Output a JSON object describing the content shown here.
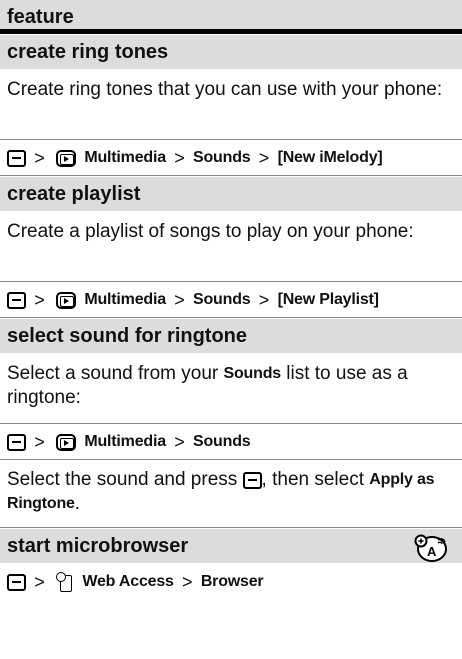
{
  "header": {
    "title": "feature"
  },
  "sections": [
    {
      "title": "create ring tones",
      "description": "Create ring tones that you can use with your phone:",
      "path": [
        "Multimedia",
        "Sounds",
        "[New iMelody]"
      ]
    },
    {
      "title": "create playlist",
      "description": "Create a playlist of songs to play on your phone:",
      "path": [
        "Multimedia",
        "Sounds",
        "[New Playlist]"
      ]
    },
    {
      "title": "select sound for ringtone",
      "desc_part1": "Select a sound from your",
      "desc_bold": "Sounds",
      "desc_part2": "list to use as a ringtone:",
      "path": [
        "Multimedia",
        "Sounds"
      ],
      "instr_part1": "Select the sound and press",
      "instr_part2": ", then select",
      "instr_bold": "Apply as Ringtone",
      "instr_end": "."
    },
    {
      "title": "start microbrowser",
      "path": [
        "Web Access",
        "Browser"
      ]
    }
  ],
  "separator": ">",
  "icons": {
    "menu_key": "menu-key-icon",
    "multimedia": "multimedia-icon",
    "web": "web-access-icon",
    "network": "network-feature-icon"
  }
}
